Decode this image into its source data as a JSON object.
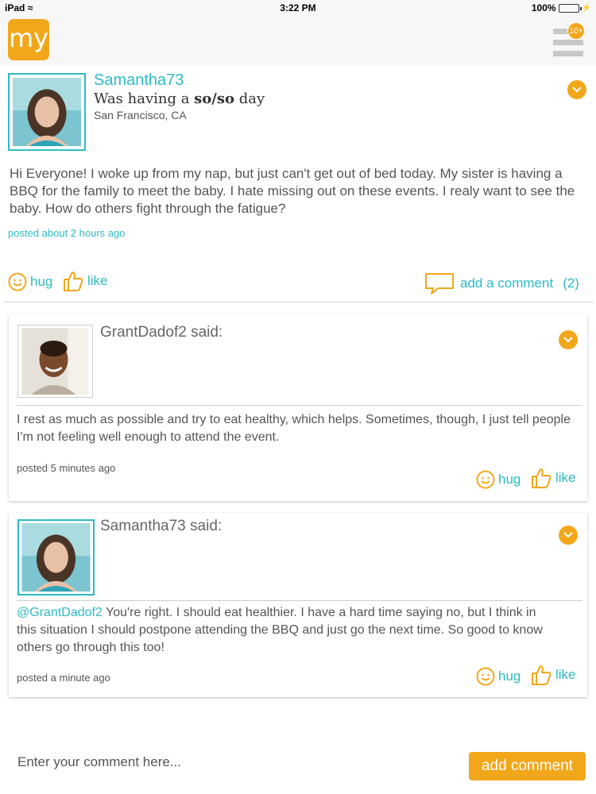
{
  "status_bar": {
    "device": "iPad",
    "time": "3:22 PM",
    "battery": "100%"
  },
  "header": {
    "logo_text": "my",
    "notification_badge": "10+"
  },
  "post": {
    "username": "Samantha73",
    "mood_prefix": "Was having a ",
    "mood_value": "so/so",
    "mood_suffix": " day",
    "location": "San Francisco, CA",
    "body": "Hi Everyone! I woke up from my nap, but just can't get out of bed today. My sister is having a BBQ for the family to meet the baby. I hate missing out on these events. I realy want to see the baby. How do others fight through the fatigue?",
    "timestamp": "posted about 2 hours ago",
    "hug_label": "hug",
    "like_label": "like",
    "comment_label": "add a comment",
    "comment_count": "(2)"
  },
  "comments": [
    {
      "said": "GrantDadof2 said:",
      "mention": "",
      "text": "I rest as much as possible and try to eat healthy, which helps. Sometimes, though, I just tell people I'm not feeling well enough to attend the event.",
      "timestamp": "posted 5 minutes ago",
      "hug_label": "hug",
      "like_label": "like"
    },
    {
      "said": "Samantha73 said:",
      "mention": "@GrantDadof2",
      "text": " You're right. I should eat healthier. I have a hard time saying no, but I think in this situation I should postpone attending the BBQ and just go the next time. So good to know others go through this too!",
      "timestamp": "posted a minute ago",
      "hug_label": "hug",
      "like_label": "like"
    }
  ],
  "compose": {
    "placeholder": "Enter your comment here...",
    "button_label": "add comment"
  },
  "colors": {
    "accent_orange": "#f2a71b",
    "accent_teal": "#2dbbc4"
  }
}
